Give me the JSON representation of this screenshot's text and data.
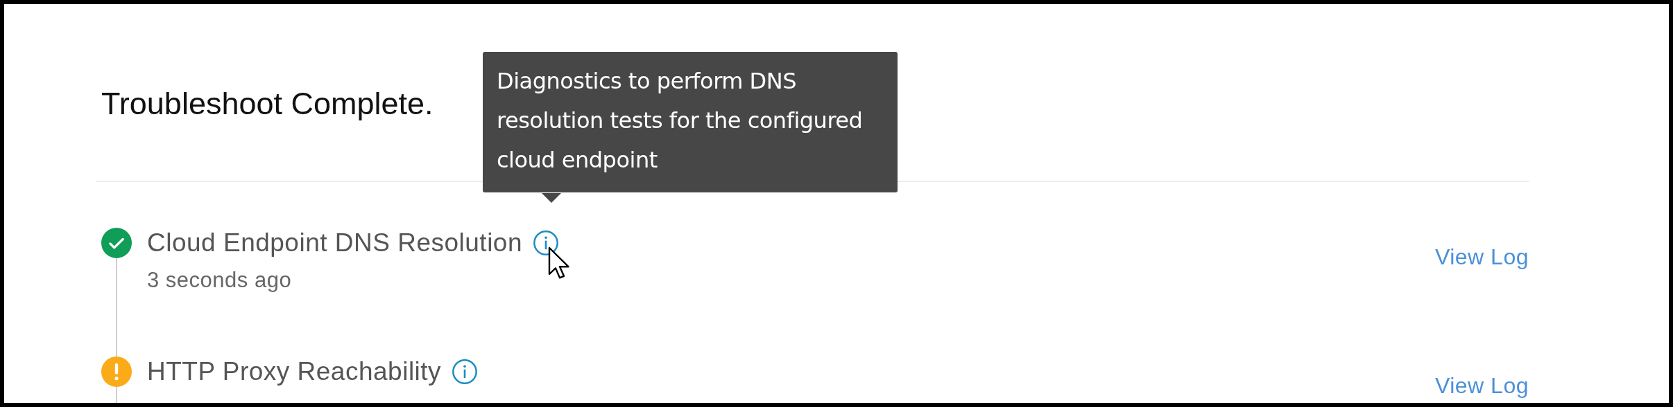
{
  "title": "Troubleshoot Complete.",
  "steps": [
    {
      "name": "Cloud Endpoint DNS Resolution",
      "kind": "success",
      "time": "3 seconds ago",
      "action": "View Log",
      "tooltip": "Diagnostics to perform DNS resolution tests for the configured cloud endpoint"
    },
    {
      "name": "HTTP Proxy Reachability",
      "kind": "warning",
      "action": "View Log"
    }
  ]
}
